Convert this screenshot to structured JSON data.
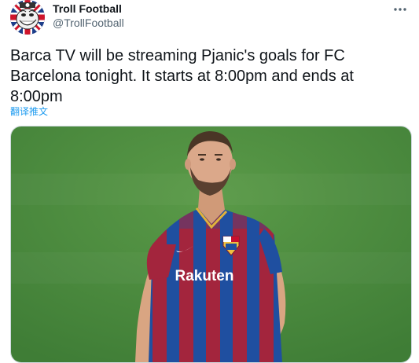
{
  "author": {
    "display_name": "Troll Football",
    "handle": "@TrollFootball",
    "avatar_icon": "troll-face-union-jack-icon"
  },
  "more_icon": "more-dots-icon",
  "tweet": {
    "text": "Barca TV will be streaming Pjanic's goals for FC\nBarcelona tonight. It starts at 8:00pm and ends at\n8:00pm",
    "translate_label": "翻译推文"
  },
  "media": {
    "jersey_sponsor": "Rakuten",
    "colors": {
      "pitch": "#4a8a3e",
      "jersey_blue": "#1f4fa0",
      "jersey_red": "#a3253d",
      "accent_link": "#1d9bf0"
    }
  }
}
